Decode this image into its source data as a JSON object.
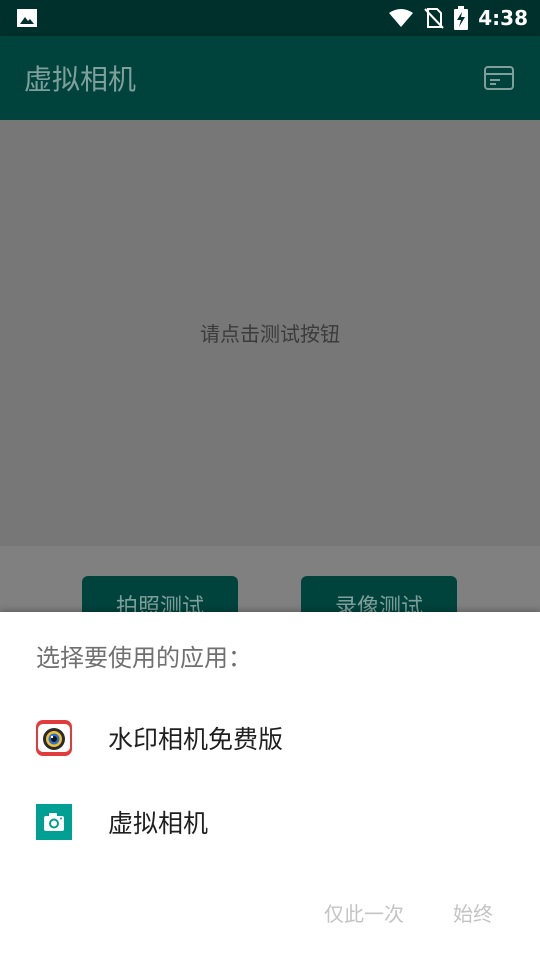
{
  "status_bar": {
    "time": "4:38",
    "icons": [
      "image-icon",
      "wifi-icon",
      "no-sim-icon",
      "battery-charging-icon"
    ]
  },
  "app_bar": {
    "title": "虚拟相机",
    "menu_icon": "card-icon"
  },
  "content": {
    "hint": "请点击测试按钮",
    "buttons": [
      {
        "label": "拍照测试"
      },
      {
        "label": "录像测试"
      }
    ]
  },
  "chooser": {
    "title": "选择要使用的应用：",
    "apps": [
      {
        "label": "水印相机免费版",
        "icon": "watermark-camera-icon"
      },
      {
        "label": "虚拟相机",
        "icon": "virtual-camera-icon"
      }
    ],
    "actions": {
      "once": "仅此一次",
      "always": "始终"
    }
  },
  "colors": {
    "status_bar": "#00302b",
    "app_bar": "#00433d",
    "scrim_content": "#777777",
    "accent_teal": "#009f93"
  }
}
